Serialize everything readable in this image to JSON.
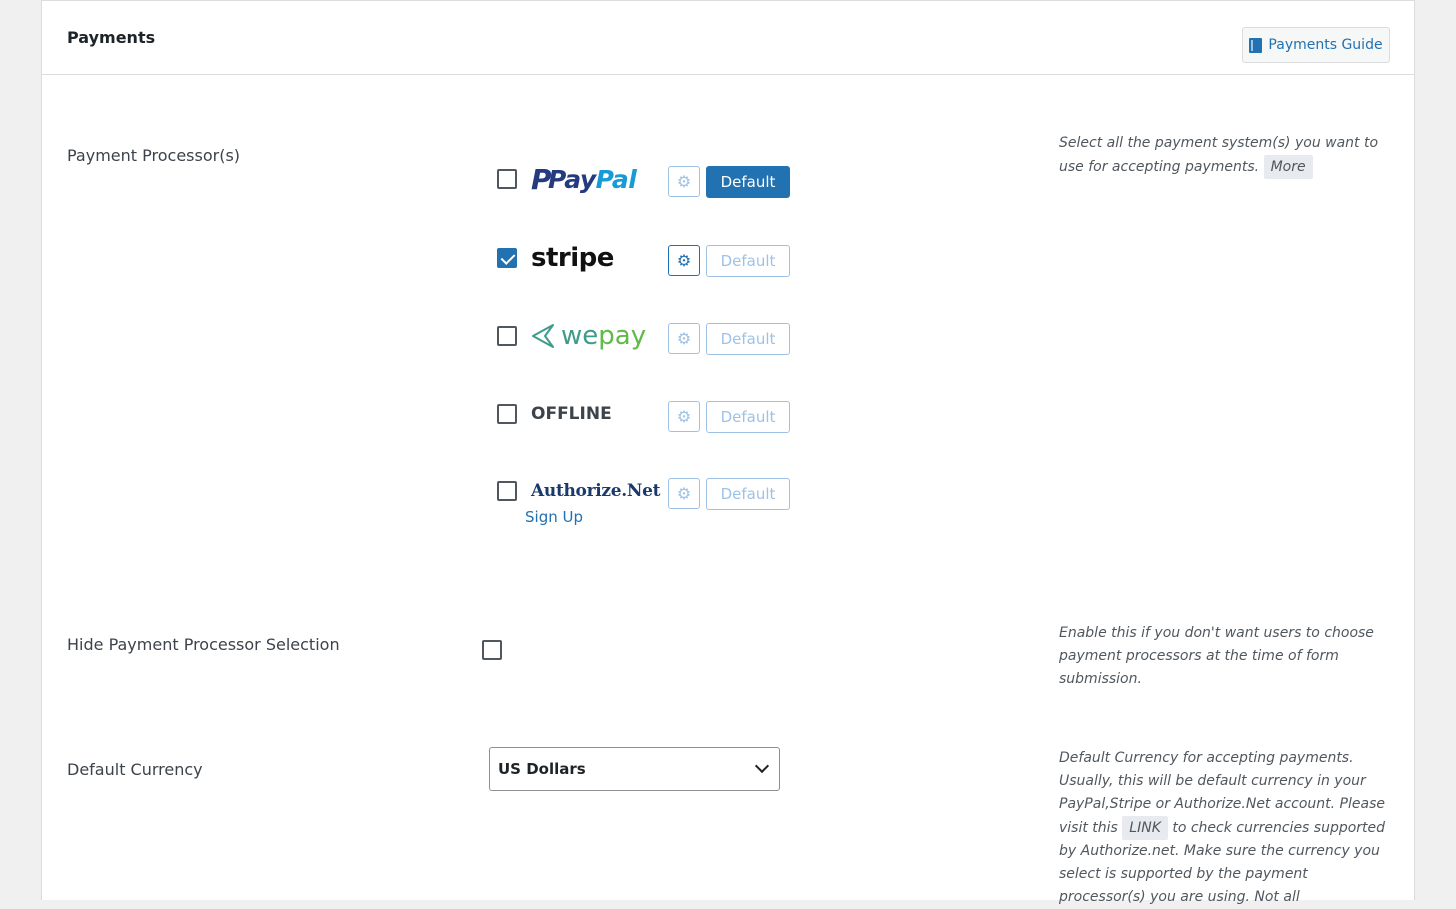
{
  "header": {
    "title": "Payments",
    "guide_label": "Payments Guide"
  },
  "processors_section": {
    "label": "Payment Processor(s)",
    "help_text": "Select all the payment system(s) you want to use for accepting payments.",
    "help_more": "More",
    "items": [
      {
        "name": "PayPal",
        "checked": false,
        "default_label": "Default",
        "is_default": true,
        "gear_active": false
      },
      {
        "name": "stripe",
        "checked": true,
        "default_label": "Default",
        "is_default": false,
        "gear_active": true
      },
      {
        "name": "wepay",
        "checked": false,
        "default_label": "Default",
        "is_default": false,
        "gear_active": false
      },
      {
        "name": "OFFLINE",
        "checked": false,
        "default_label": "Default",
        "is_default": false,
        "gear_active": false
      },
      {
        "name": "Authorize.Net",
        "checked": false,
        "default_label": "Default",
        "is_default": false,
        "gear_active": false,
        "signup_label": "Sign Up"
      }
    ]
  },
  "hide_section": {
    "label": "Hide Payment Processor Selection",
    "checked": false,
    "help_text": "Enable this if you don't want users to choose payment processors at the time of form submission."
  },
  "currency_section": {
    "label": "Default Currency",
    "selected": "US Dollars",
    "help_part1": "Default Currency for accepting payments. Usually, this will be default currency in your PayPal,Stripe or Authorize.Net account. Please visit this",
    "help_link": "LINK",
    "help_part2": "to check currencies supported by Authorize.net. Make sure the currency you select is supported by the payment processor(s) you are using. Not all"
  },
  "colors": {
    "accent": "#2271b1",
    "accent_light": "#9ec2e6",
    "paypal_dark": "#253b80",
    "paypal_light": "#179bd7",
    "wepay_green": "#5fba46"
  }
}
